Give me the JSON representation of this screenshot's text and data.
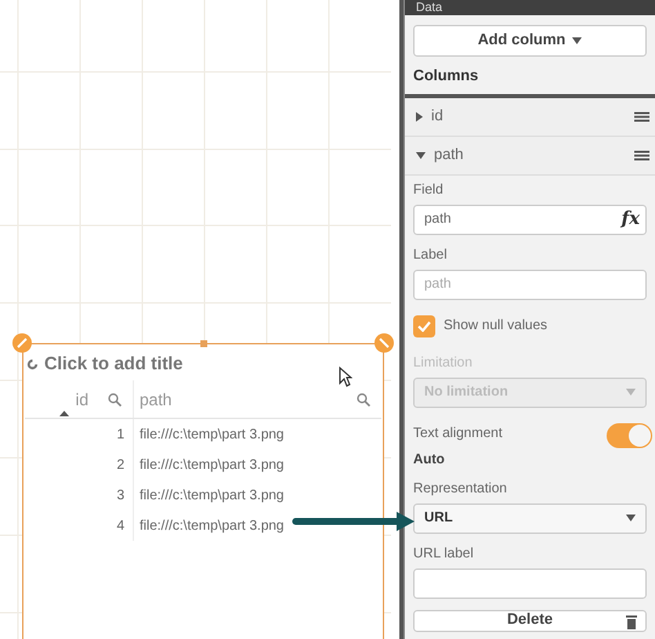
{
  "table_object": {
    "title": "Click to add title",
    "columns": [
      {
        "label": "id",
        "sorted": true
      },
      {
        "label": "path",
        "sorted": false
      }
    ],
    "rows": [
      [
        "1",
        "file:///c:\\temp\\part 3.png"
      ],
      [
        "2",
        "file:///c:\\temp\\part 3.png"
      ],
      [
        "3",
        "file:///c:\\temp\\part 3.png"
      ],
      [
        "4",
        "file:///c:\\temp\\part 3.png"
      ]
    ]
  },
  "panel": {
    "title": "Data",
    "add_column": "Add column",
    "columns_heading": "Columns",
    "columns": [
      {
        "name": "id",
        "expanded": false
      },
      {
        "name": "path",
        "expanded": true
      }
    ],
    "field": {
      "label": "Field",
      "value": "path",
      "formula_button": "fx"
    },
    "label_field": {
      "label": "Label",
      "placeholder": "path"
    },
    "show_null": {
      "label": "Show null values",
      "checked": true
    },
    "limitation": {
      "label": "Limitation",
      "value": "No limitation",
      "disabled": true
    },
    "text_alignment": {
      "label": "Text alignment",
      "value": "Auto",
      "on": true
    },
    "representation": {
      "label": "Representation",
      "value": "URL"
    },
    "url_label": {
      "label": "URL label"
    },
    "delete_button": "Delete"
  }
}
